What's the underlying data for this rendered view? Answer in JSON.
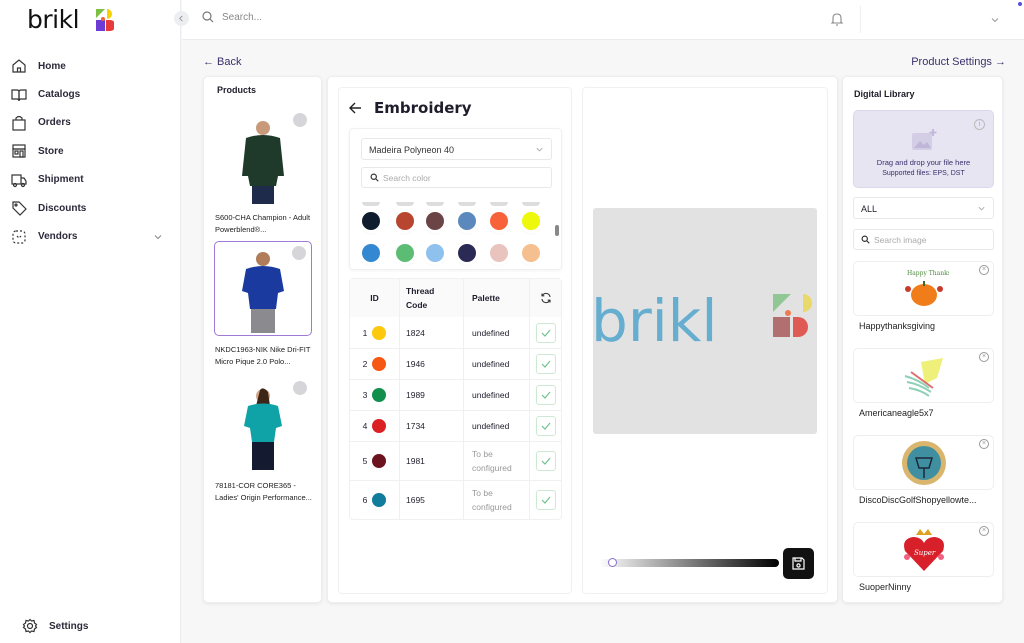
{
  "app": {
    "brand": "brikl"
  },
  "sidebar": {
    "items": [
      {
        "label": "Home",
        "icon": "home-icon"
      },
      {
        "label": "Catalogs",
        "icon": "book-icon"
      },
      {
        "label": "Orders",
        "icon": "shopping-bag-icon"
      },
      {
        "label": "Store",
        "icon": "store-icon"
      },
      {
        "label": "Shipment",
        "icon": "truck-icon"
      },
      {
        "label": "Discounts",
        "icon": "tag-icon"
      },
      {
        "label": "Vendors",
        "icon": "vendors-icon",
        "expandable": true
      }
    ],
    "settings_label": "Settings"
  },
  "topbar": {
    "search_placeholder": "Search...",
    "user_value": ""
  },
  "nav": {
    "back_label": "← Back",
    "product_settings_label": "Product Settings →"
  },
  "products": {
    "title": "Products",
    "items": [
      {
        "name": "S600-CHA Champion - Adult Powerblend®...",
        "color": "#1f3a2b",
        "selected": false
      },
      {
        "name": "NKDC1963-NIK Nike Dri-FIT Micro Pique 2.0 Polo...",
        "color": "#1b3aa0",
        "selected": true
      },
      {
        "name": "78181-COR CORE365 - Ladies' Origin Performance...",
        "color": "#0fa3a8",
        "selected": false
      }
    ]
  },
  "embroidery": {
    "title": "Embroidery",
    "thread_brand": "Madeira Polyneon 40",
    "search_color_placeholder": "Search color",
    "swatches_row1": [
      "#0f1c2e",
      "#b84530",
      "#6b4446",
      "#5c89bd",
      "#f7623a",
      "#eef80d"
    ],
    "swatches_row2": [
      "#3488d1",
      "#5bbd74",
      "#8ec1ee",
      "#2a2a55",
      "#e9c3bd",
      "#f5bf8f"
    ],
    "table": {
      "headers": {
        "id": "ID",
        "thread_code": "Thread Code",
        "palette": "Palette"
      },
      "rows": [
        {
          "id": "1",
          "color": "#fdc90c",
          "code": "1824",
          "palette": "undefined",
          "configured": true
        },
        {
          "id": "2",
          "color": "#f75714",
          "code": "1946",
          "palette": "undefined",
          "configured": true
        },
        {
          "id": "3",
          "color": "#138f4c",
          "code": "1989",
          "palette": "undefined",
          "configured": true
        },
        {
          "id": "4",
          "color": "#da2023",
          "code": "1734",
          "palette": "undefined",
          "configured": true
        },
        {
          "id": "5",
          "color": "#6b1420",
          "code": "1981",
          "palette": "To be configured",
          "configured": false
        },
        {
          "id": "6",
          "color": "#117c9b",
          "code": "1695",
          "palette": "To be configured",
          "configured": false
        }
      ]
    }
  },
  "preview": {
    "logo_text": "brikl",
    "slider_value": 0.05
  },
  "library": {
    "title": "Digital Library",
    "drop_text": "Drag and drop your file here",
    "supported_text": "Supported files: EPS, DST",
    "filter_value": "ALL",
    "search_placeholder": "Search image",
    "items": [
      {
        "name": "Happythanksgiving"
      },
      {
        "name": "Americaneagle5x7"
      },
      {
        "name": "DiscoDiscGolfShopyellowte..."
      },
      {
        "name": "SuoperNinny"
      }
    ]
  }
}
